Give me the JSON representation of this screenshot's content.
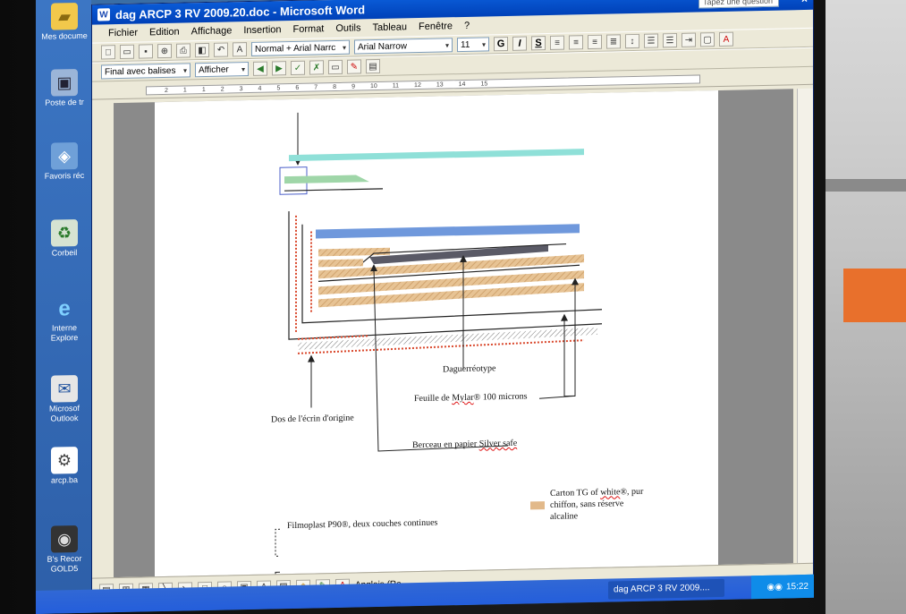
{
  "desktop": {
    "icons": [
      {
        "label": "Mes docume",
        "icon": "folder-icon"
      },
      {
        "label": "Poste de tr",
        "icon": "computer-icon"
      },
      {
        "label": "Favoris réc",
        "icon": "network-icon"
      },
      {
        "label": "Corbeil",
        "icon": "recycle-bin-icon"
      },
      {
        "label": "Interne Explore",
        "icon": "ie-icon"
      },
      {
        "label": "Microsof Outlook",
        "icon": "outlook-icon"
      },
      {
        "label": "arcp.ba",
        "icon": "file-icon"
      },
      {
        "label": "B's Recor GOLD5",
        "icon": "cd-icon"
      }
    ]
  },
  "window": {
    "title": "dag ARCP 3 RV 2009.20.doc - Microsoft Word",
    "help_placeholder": "Tapez une question",
    "close": "×"
  },
  "menu": [
    "Fichier",
    "Edition",
    "Affichage",
    "Insertion",
    "Format",
    "Outils",
    "Tableau",
    "Fenêtre",
    "?"
  ],
  "toolbar": {
    "style_combo": "Normal + Arial Narrc",
    "font_combo": "Arial Narrow",
    "size_combo": "11",
    "bold": "G",
    "italic": "I",
    "underline": "S"
  },
  "review_toolbar": {
    "display_combo": "Final avec balises",
    "show_button": "Afficher"
  },
  "ruler": {
    "ticks": [
      "2",
      "1",
      "1",
      "2",
      "3",
      "4",
      "5",
      "6",
      "7",
      "8",
      "9",
      "10",
      "11",
      "12",
      "13",
      "14",
      "15"
    ]
  },
  "diagram": {
    "label_daguerreotype": "Daguerréotype",
    "label_mylar_prefix": "Feuille de ",
    "label_mylar_word": "Mylar",
    "label_mylar_suffix": "® 100 microns",
    "label_dos": "Dos de l'écrin d'origine",
    "label_berceau_prefix": "Berceau en papier ",
    "label_berceau_word": "Silver safe"
  },
  "legend": {
    "filmoplast": "Filmoplast P90®, deux couches continues",
    "carton_prefix": "Carton TG of ",
    "carton_word": "white",
    "carton_suffix": "®, pur chiffon, sans réserve alcaline"
  },
  "statusbar": {
    "language": "Anglais (Ro"
  },
  "taskbar": {
    "task": "dag ARCP 3 RV 2009....",
    "clock": "15:22"
  },
  "colors": {
    "teal": "#8fe0d8",
    "green": "#9fd6a8",
    "blue": "#6f98dc",
    "tan": "#e2b98a",
    "gray_bar": "#5a5a66",
    "red_dots": "#d9472b"
  }
}
